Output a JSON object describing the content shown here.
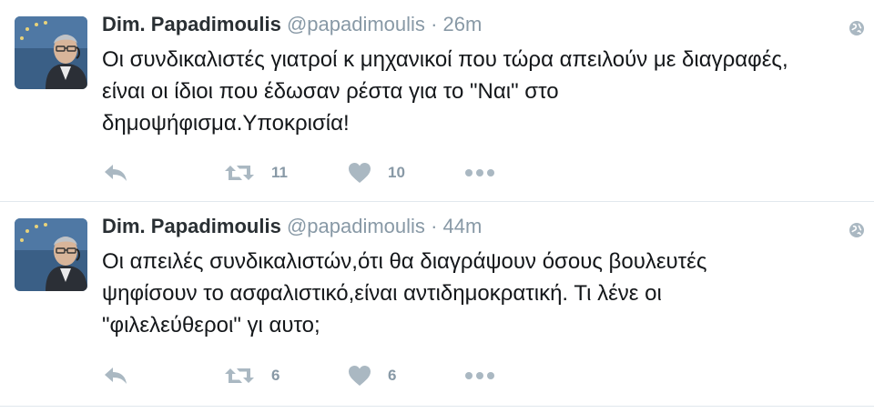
{
  "tweets": [
    {
      "name": "Dim. Papadimoulis",
      "handle": "@papadimoulis",
      "separator": "·",
      "time": "26m",
      "text": "Οι συνδικαλιστές γιατροί κ μηχανικοί που τώρα απειλούν με διαγραφές,\nείναι οι ίδιοι που έδωσαν ρέστα για το \"Ναι\" στο\nδημοψήφισμα.Υποκρισία!",
      "retweets": "11",
      "likes": "10"
    },
    {
      "name": "Dim. Papadimoulis",
      "handle": "@papadimoulis",
      "separator": "·",
      "time": "44m",
      "text": "Οι απειλές συνδικαλιστών,ότι θα διαγράψουν όσους βουλευτές\nψηφίσουν το ασφαλιστικό,είναι αντιδημοκρατική. Τι λένε οι\n\"φιλελεύθεροι\" γι αυτο;",
      "retweets": "6",
      "likes": "6"
    }
  ],
  "icons": {
    "reply": "reply-icon",
    "retweet": "retweet-icon",
    "like": "heart-icon",
    "more": "more-icon",
    "globe": "globe-icon"
  },
  "colors": {
    "name": "#292f33",
    "muted": "#8899a6",
    "icon": "#aab8c2",
    "divider": "#e1e8ed"
  }
}
